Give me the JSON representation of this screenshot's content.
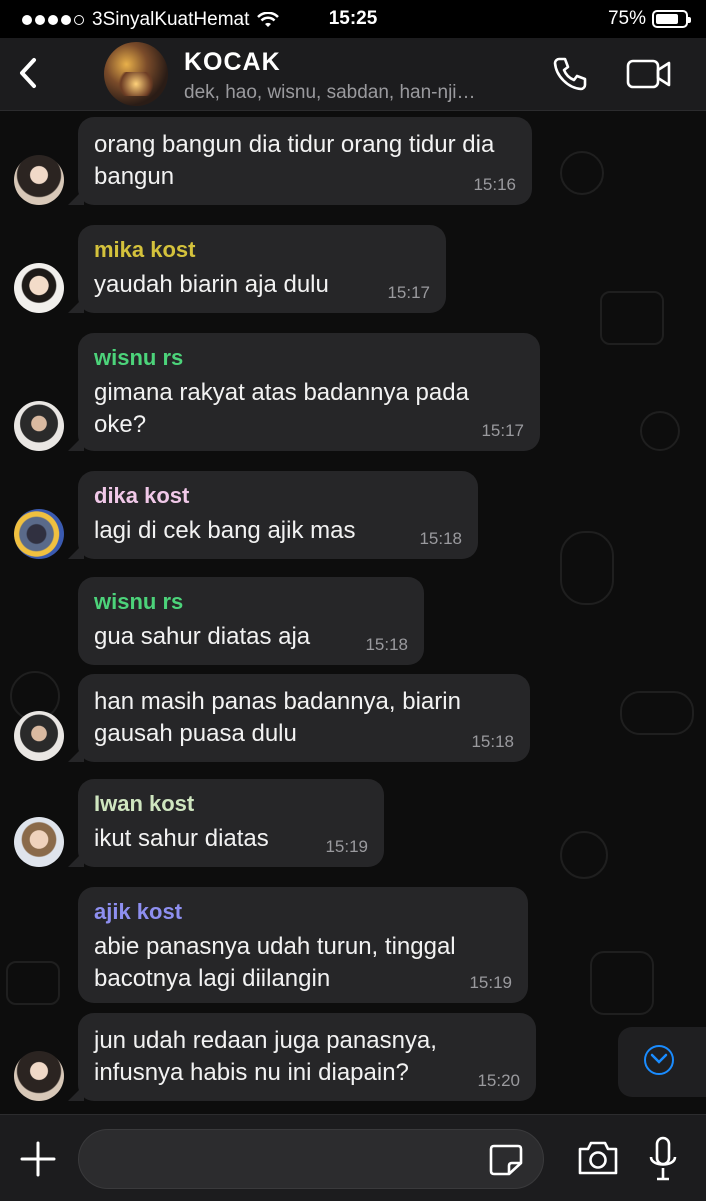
{
  "status_bar": {
    "carrier": "3SinyalKuatHemat",
    "time": "15:25",
    "battery": "75%",
    "battery_level": 0.75
  },
  "header": {
    "title": "KOCAK",
    "members": "dek, hao, wisnu, sabdan, han-nji…"
  },
  "messages": [
    {
      "sender": "",
      "text": "orang bangun dia tidur orang tidur dia bangun",
      "time": "15:16"
    },
    {
      "sender": "mika kost",
      "sender_color": "#d4c23c",
      "text": "yaudah biarin aja dulu",
      "time": "15:17"
    },
    {
      "sender": "wisnu rs",
      "sender_color": "#4cd37a",
      "text": "gimana rakyat atas badannya pada oke?",
      "time": "15:17"
    },
    {
      "sender": "dika kost",
      "sender_color": "#f0c8e8",
      "text": "lagi di cek bang ajik mas",
      "time": "15:18"
    },
    {
      "sender": "wisnu rs",
      "sender_color": "#4cd37a",
      "text": "gua sahur diatas aja",
      "time": "15:18"
    },
    {
      "sender": "",
      "text": "han masih panas badannya, biarin gausah puasa dulu",
      "time": "15:18"
    },
    {
      "sender": "Iwan kost",
      "sender_color": "#cfe6c0",
      "text": "ikut sahur diatas",
      "time": "15:19"
    },
    {
      "sender": "ajik kost",
      "sender_color": "#8e8ff0",
      "text": "abie panasnya udah turun, tinggal bacotnya lagi diilangin",
      "time": "15:19"
    },
    {
      "sender": "",
      "text": "jun udah redaan juga panasnya, infusnya habis nu ini diapain?",
      "time": "15:20"
    }
  ],
  "input": {
    "value": "",
    "placeholder": ""
  },
  "icons": {
    "back": "chevron-left-icon",
    "call": "phone-icon",
    "video": "video-camera-icon",
    "scroll_down": "chevron-down-circle-icon",
    "attach": "plus-icon",
    "sticker": "sticker-icon",
    "camera": "camera-icon",
    "mic": "microphone-icon"
  },
  "colors": {
    "accent": "#1a8cff",
    "bubble": "#262628",
    "background": "#0d0d0d"
  }
}
